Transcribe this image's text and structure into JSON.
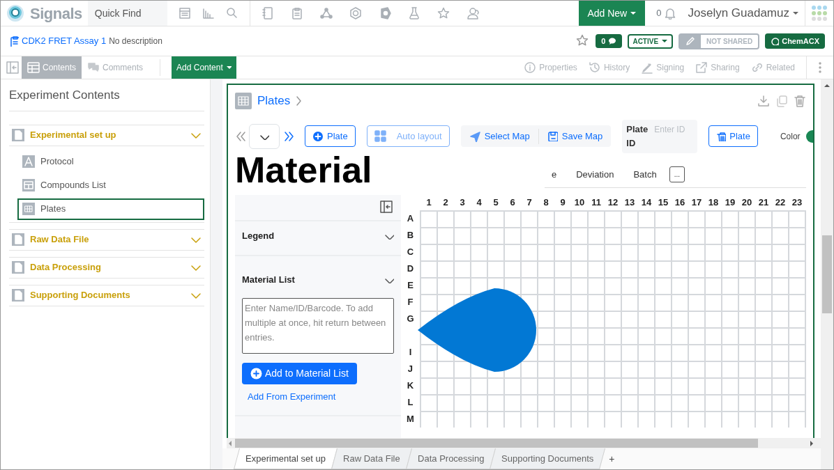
{
  "topbar": {
    "logo": "Signals",
    "quick_find": "Quick Find",
    "add_new": "Add New",
    "notification_count": "0",
    "user": "Joselyn Guadamuz"
  },
  "experiment": {
    "title": "CDK2 FRET Assay 1",
    "description": "No description",
    "starred": false,
    "comment_count": "0",
    "status": "ACTIVE",
    "sharing": "NOT SHARED",
    "shared": false,
    "search_button": "ChemACX"
  },
  "toolbar": {
    "tabs": [
      {
        "label": "Contents",
        "kind": "contents",
        "selected": true
      },
      {
        "label": "Comments",
        "kind": "comments",
        "selected": false
      }
    ],
    "add_content": "Add Content",
    "actions": [
      {
        "label": "Properties",
        "kind": "info"
      },
      {
        "label": "History",
        "kind": "history"
      },
      {
        "label": "Signing",
        "kind": "sign"
      },
      {
        "label": "Sharing",
        "kind": "share"
      },
      {
        "label": "Related",
        "kind": "link"
      }
    ]
  },
  "sidebar": {
    "title": "Experiment Contents",
    "sections": [
      {
        "label": "Experimental set up",
        "expanded": true,
        "children": [
          {
            "label": "Protocol",
            "kind": "text",
            "selected": false
          },
          {
            "label": "Compounds List",
            "kind": "table",
            "selected": false
          },
          {
            "label": "Plates",
            "kind": "plate",
            "selected": true
          }
        ]
      },
      {
        "label": "Raw Data File"
      },
      {
        "label": "Data Processing"
      },
      {
        "label": "Supporting Documents"
      }
    ]
  },
  "plates": {
    "title": "Plates",
    "add_plate": "Plate",
    "auto_layout": "Auto layout",
    "select_map": "Select Map",
    "save_map": "Save Map",
    "plate_id_label": "Plate ID",
    "plate_id_placeholder": "Enter ID",
    "delete_plate": "Plate",
    "color_toggle": {
      "label": "Color",
      "on": true
    },
    "overlay_heading": "Material",
    "tabs": [
      "e",
      "Deviation",
      "Batch"
    ],
    "more_tabs": "...",
    "panel": {
      "sections": [
        {
          "label": "Legend"
        },
        {
          "label": "Material List",
          "expanded": true
        }
      ],
      "material_placeholder": "Enter Name/ID/Barcode. To add multiple at once, hit return between entries.",
      "add_button": "Add to Material List",
      "add_from": "Add From Experiment"
    },
    "columns": [
      "1",
      "2",
      "3",
      "4",
      "5",
      "6",
      "7",
      "8",
      "9",
      "10",
      "11",
      "12",
      "13",
      "14",
      "15",
      "16",
      "17",
      "18",
      "19",
      "20",
      "21",
      "22",
      "23"
    ],
    "rows": [
      {
        "label": "A"
      },
      {
        "label": "B"
      },
      {
        "label": "C"
      },
      {
        "label": "D"
      },
      {
        "label": "E"
      },
      {
        "label": "F"
      },
      {
        "label": "G"
      },
      {},
      {
        "label": "I"
      },
      {
        "label": "J"
      },
      {
        "label": "K"
      },
      {
        "label": "L"
      },
      {
        "label": "M"
      }
    ]
  },
  "bottom_tabs": [
    {
      "label": "Experimental set up",
      "selected": true
    },
    {
      "label": "Raw Data File",
      "selected": false
    },
    {
      "label": "Data Processing",
      "selected": false
    },
    {
      "label": "Supporting Documents",
      "selected": false
    }
  ],
  "add_tab": "+"
}
